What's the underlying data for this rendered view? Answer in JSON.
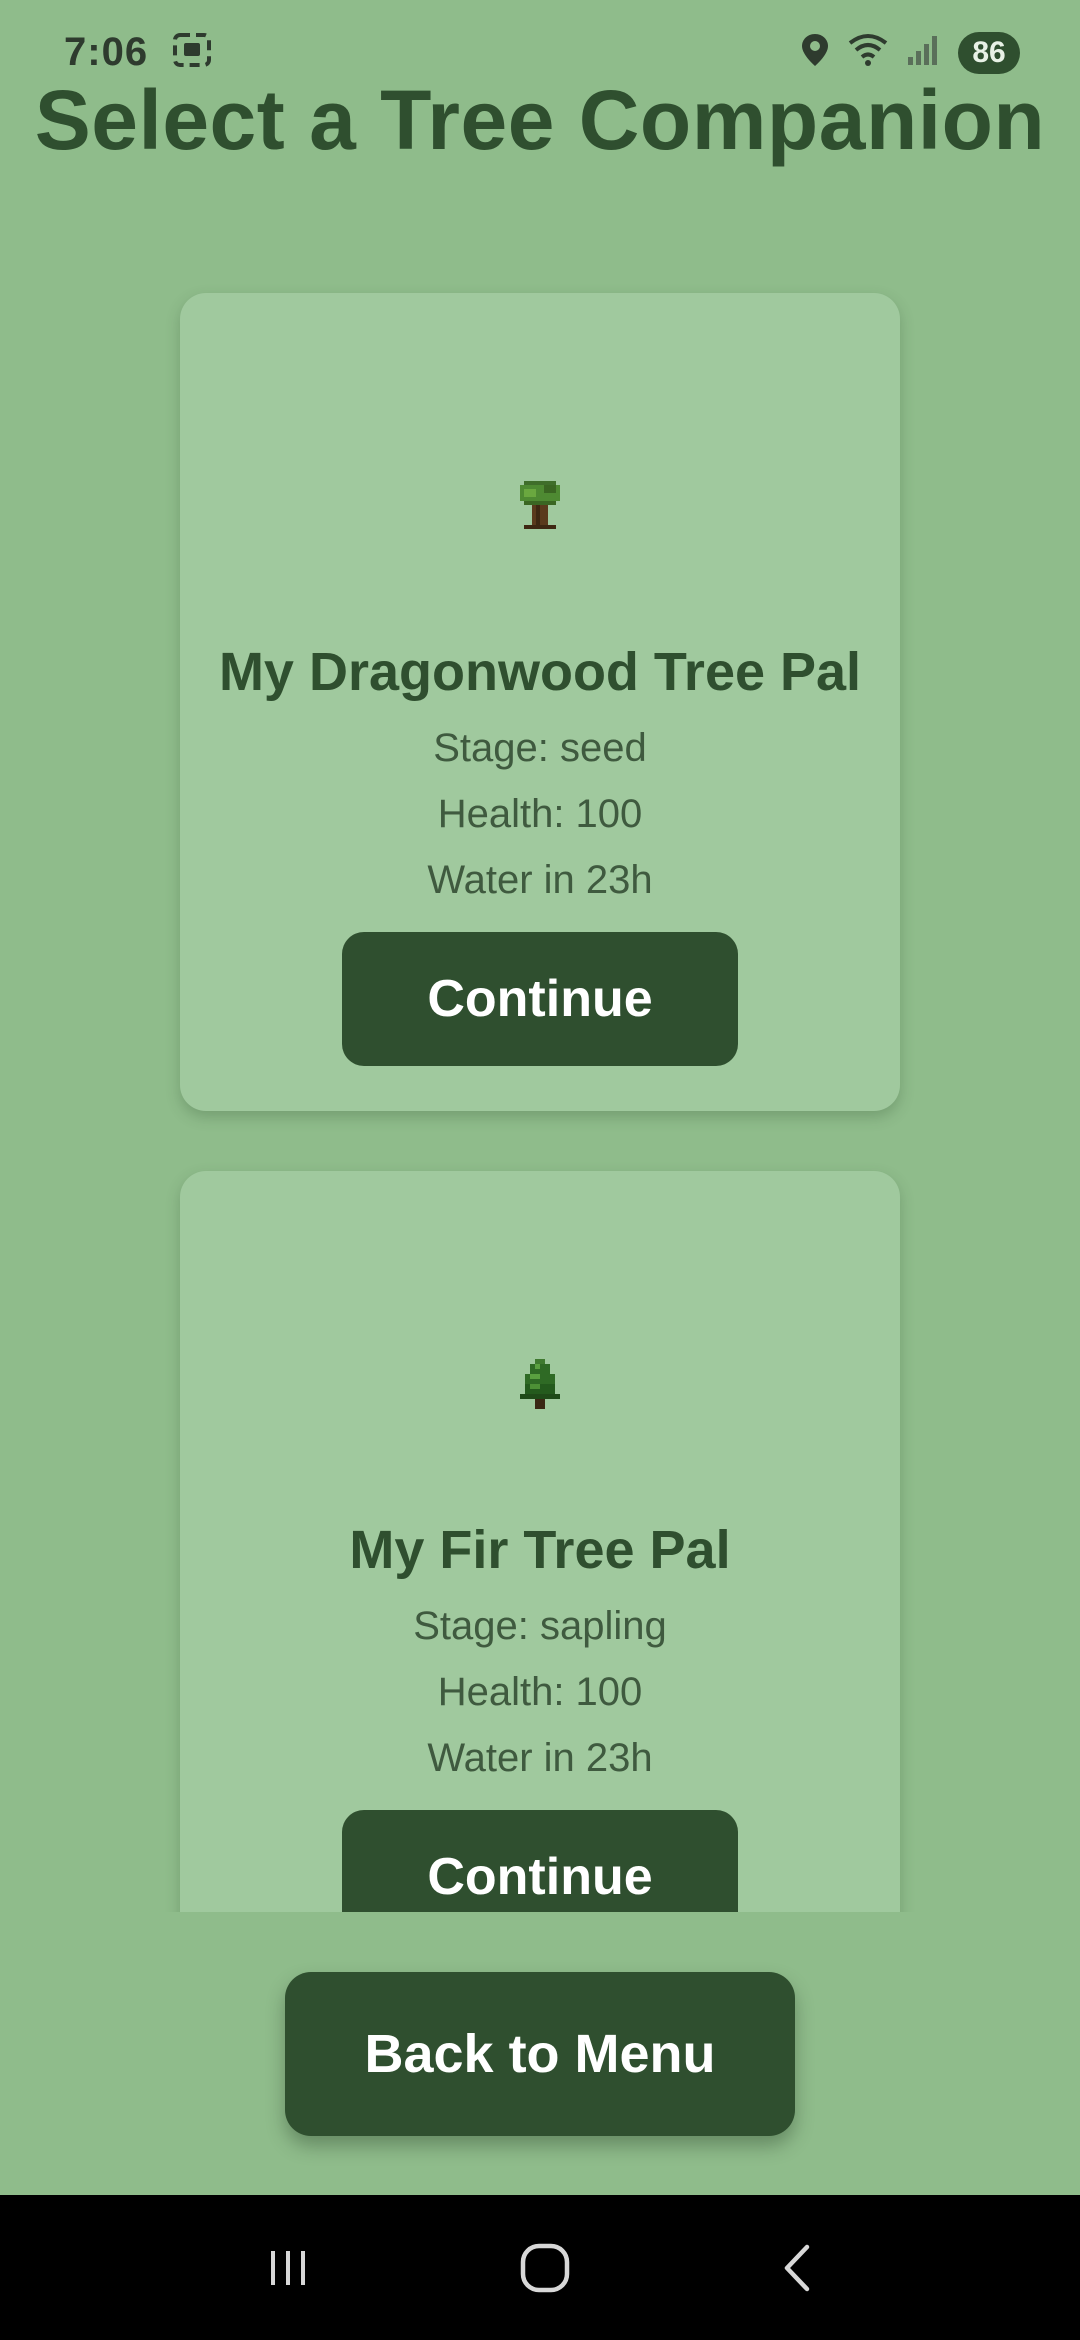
{
  "status_bar": {
    "time": "7:06",
    "battery": "86",
    "icons": [
      "screenshot-icon",
      "location-icon",
      "wifi-icon",
      "signal-icon"
    ]
  },
  "page": {
    "title": "Select a Tree Companion"
  },
  "trees": [
    {
      "name": "My Dragonwood Tree Pal",
      "stage": "Stage: seed",
      "health": "Health: 100",
      "water": "Water in 23h",
      "continue_label": "Continue",
      "icon": "dragonwood-tree-icon"
    },
    {
      "name": "My Fir Tree Pal",
      "stage": "Stage: sapling",
      "health": "Health: 100",
      "water": "Water in 23h",
      "continue_label": "Continue",
      "icon": "fir-tree-icon"
    }
  ],
  "footer": {
    "back_label": "Back to Menu"
  },
  "nav": {
    "icons": [
      "recent-apps-icon",
      "home-icon",
      "back-icon"
    ]
  },
  "colors": {
    "background": "#8fbc8b",
    "card": "#a0c99e",
    "primary": "#2f4f2f",
    "button_text": "#ffffff"
  }
}
